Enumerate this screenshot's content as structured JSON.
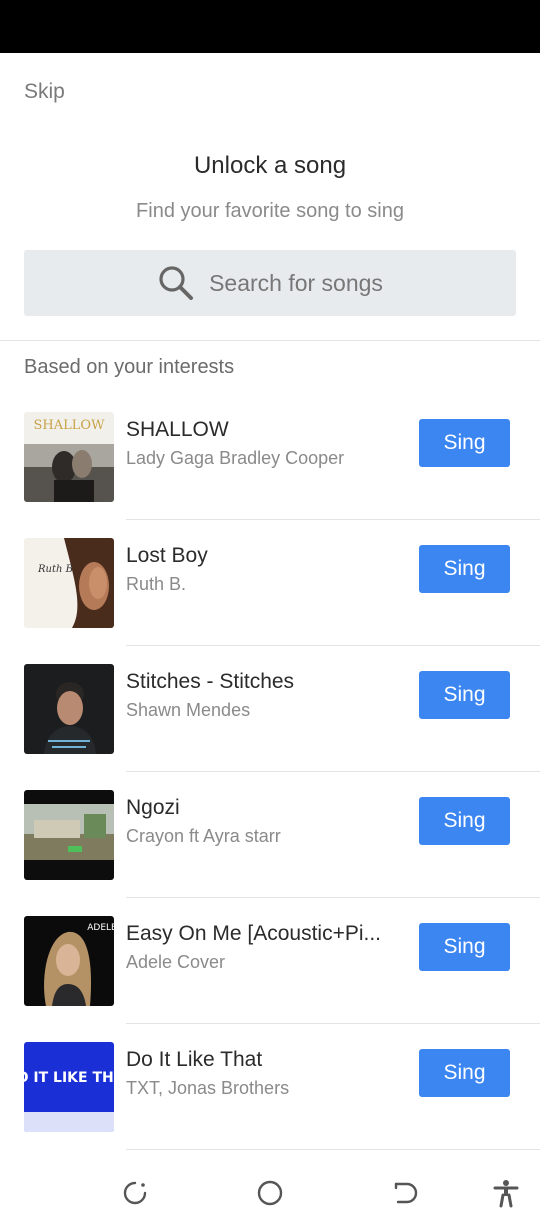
{
  "header": {
    "skip_label": "Skip",
    "title": "Unlock a song",
    "subtitle": "Find your favorite song to sing"
  },
  "search": {
    "placeholder": "Search for songs"
  },
  "section": {
    "title": "Based on your interests"
  },
  "songs": [
    {
      "title": "SHALLOW",
      "artist": "Lady Gaga Bradley Cooper",
      "button": "Sing"
    },
    {
      "title": "Lost Boy",
      "artist": "Ruth B.",
      "button": "Sing"
    },
    {
      "title": "Stitches - Stitches",
      "artist": "Shawn Mendes",
      "button": "Sing"
    },
    {
      "title": "Ngozi",
      "artist": "Crayon ft Ayra starr",
      "button": "Sing"
    },
    {
      "title": "Easy On Me [Acoustic+Pi...",
      "artist": "Adele Cover",
      "button": "Sing"
    },
    {
      "title": "Do It Like That",
      "artist": "TXT, Jonas Brothers",
      "button": "Sing"
    }
  ],
  "cover_text": {
    "shallow": "SHALLOW",
    "ruth": "Ruth B",
    "adele": "ADELE",
    "doit": "DO IT LIKE THAT"
  },
  "colors": {
    "accent": "#3b86f1",
    "status_bar": "#000000",
    "search_bg": "#e8ebed"
  },
  "navbar": {
    "icons": [
      "rotate-icon",
      "home-circle-icon",
      "back-icon",
      "accessibility-icon"
    ]
  }
}
